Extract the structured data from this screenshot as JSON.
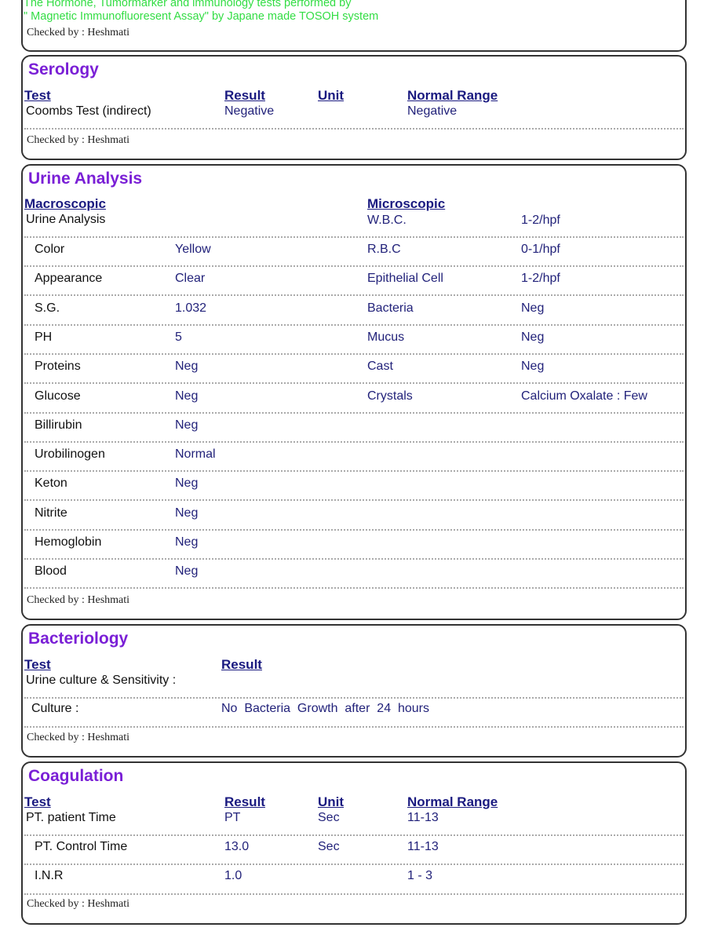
{
  "header_note": {
    "line1": "The Hormone, Tumormarker and immunology tests  performed by",
    "line2": "\" Magnetic Immunofluoresent Assay\" by  Japane made TOSOH system",
    "checked": "Checked by : Heshmati"
  },
  "serology": {
    "title": "Serology",
    "headers": [
      "Test",
      "Result",
      "Unit",
      "Normal Range"
    ],
    "row": {
      "test": "Coombs Test (indirect)",
      "result": "Negative",
      "unit": "",
      "range": "Negative"
    },
    "checked": "Checked by : Heshmati"
  },
  "urine": {
    "title": "Urine Analysis",
    "macro_header": "Macroscopic",
    "micro_header": "Microscopic",
    "first_row": {
      "name": "Urine Analysis",
      "micro_name": "W.B.C.",
      "micro_result": "1-2/hpf"
    },
    "rows": [
      {
        "name": "Color",
        "result": "Yellow",
        "micro_name": "R.B.C",
        "micro_result": "0-1/hpf"
      },
      {
        "name": "Appearance",
        "result": "Clear",
        "micro_name": "Epithelial Cell",
        "micro_result": "1-2/hpf"
      },
      {
        "name": "S.G.",
        "result": "1.032",
        "micro_name": "Bacteria",
        "micro_result": "Neg"
      },
      {
        "name": "PH",
        "result": "5",
        "micro_name": "Mucus",
        "micro_result": "Neg"
      },
      {
        "name": "Proteins",
        "result": "Neg",
        "micro_name": "Cast",
        "micro_result": "Neg"
      },
      {
        "name": "Glucose",
        "result": "Neg",
        "micro_name": "Crystals",
        "micro_result": "Calcium Oxalate : Few"
      },
      {
        "name": "Billirubin",
        "result": "Neg",
        "micro_name": "",
        "micro_result": ""
      },
      {
        "name": "Urobilinogen",
        "result": "Normal",
        "micro_name": "",
        "micro_result": ""
      },
      {
        "name": "Keton",
        "result": "Neg",
        "micro_name": "",
        "micro_result": ""
      },
      {
        "name": "Nitrite",
        "result": "Neg",
        "micro_name": "",
        "micro_result": ""
      },
      {
        "name": "Hemoglobin",
        "result": "Neg",
        "micro_name": "",
        "micro_result": ""
      },
      {
        "name": "Blood",
        "result": "Neg",
        "micro_name": "",
        "micro_result": ""
      }
    ],
    "checked": "Checked by : Heshmati"
  },
  "bacteriology": {
    "title": "Bacteriology",
    "headers": [
      "Test",
      "Result"
    ],
    "subtitle": "Urine culture & Sensitivity :",
    "row": {
      "test": "Culture :",
      "result": "No  Bacteria  Growth  after  24  hours"
    },
    "checked": "Checked by : Heshmati"
  },
  "coagulation": {
    "title": "Coagulation",
    "headers": [
      "Test",
      "Result",
      "Unit",
      "Normal Range"
    ],
    "rows": [
      {
        "test": "PT. patient Time",
        "result": "PT",
        "unit": "Sec",
        "range": "11-13"
      },
      {
        "test": "PT. Control Time",
        "result": "13.0",
        "unit": "Sec",
        "range": "11-13"
      },
      {
        "test": "I.N.R",
        "result": "1.0",
        "unit": "",
        "range": "1 - 3"
      }
    ],
    "checked": "Checked by : Heshmati"
  }
}
